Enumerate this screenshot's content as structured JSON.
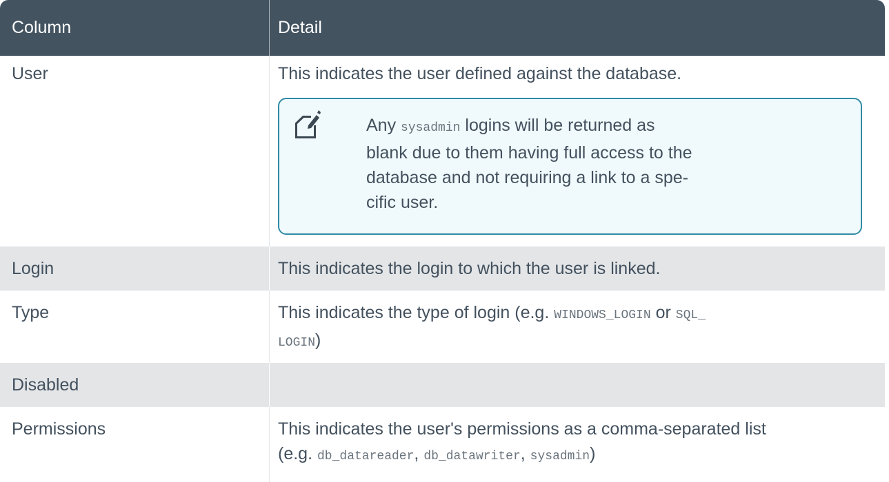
{
  "table": {
    "headers": {
      "column": "Column",
      "detail": "Detail"
    },
    "rows": [
      {
        "column": "User",
        "detail": "This indicates the user defined against the database."
      },
      {
        "column": "Login",
        "detail": "This indicates the login to which the user is linked."
      },
      {
        "column": "Type",
        "detail_prefix": "This indicates the type of login (e.g. ",
        "code_1": "WINDOWS_LOGIN",
        "detail_mid": " or ",
        "code_2": "SQL_",
        "code_3": "LOGIN",
        "detail_suffix": ")"
      },
      {
        "column": "Disabled",
        "detail": ""
      },
      {
        "column": "Permissions",
        "detail_line1": "This indicates the user's permissions as a comma-separated list",
        "detail_prefix": "(e.g. ",
        "code_1": "db_datareader",
        "sep_1": ", ",
        "code_2": "db_datawriter",
        "sep_2": ", ",
        "code_3": "sysadmin",
        "detail_suffix": ")"
      }
    ],
    "note": {
      "icon": "note-edit-icon",
      "text_prefix": "Any ",
      "code": "sysadmin",
      "line1_suffix": " logins will be returned as",
      "line2": "blank due to them having full access to the",
      "line3": "database and not requiring a link to a spe-",
      "line4": "cific user."
    }
  },
  "colors": {
    "header_bg": "#435360",
    "header_text": "#ffffff",
    "body_text": "#43515e",
    "shaded_row": "#e3e5e7",
    "note_border": "#2f8ba6",
    "note_bg": "#f0f9fb"
  }
}
